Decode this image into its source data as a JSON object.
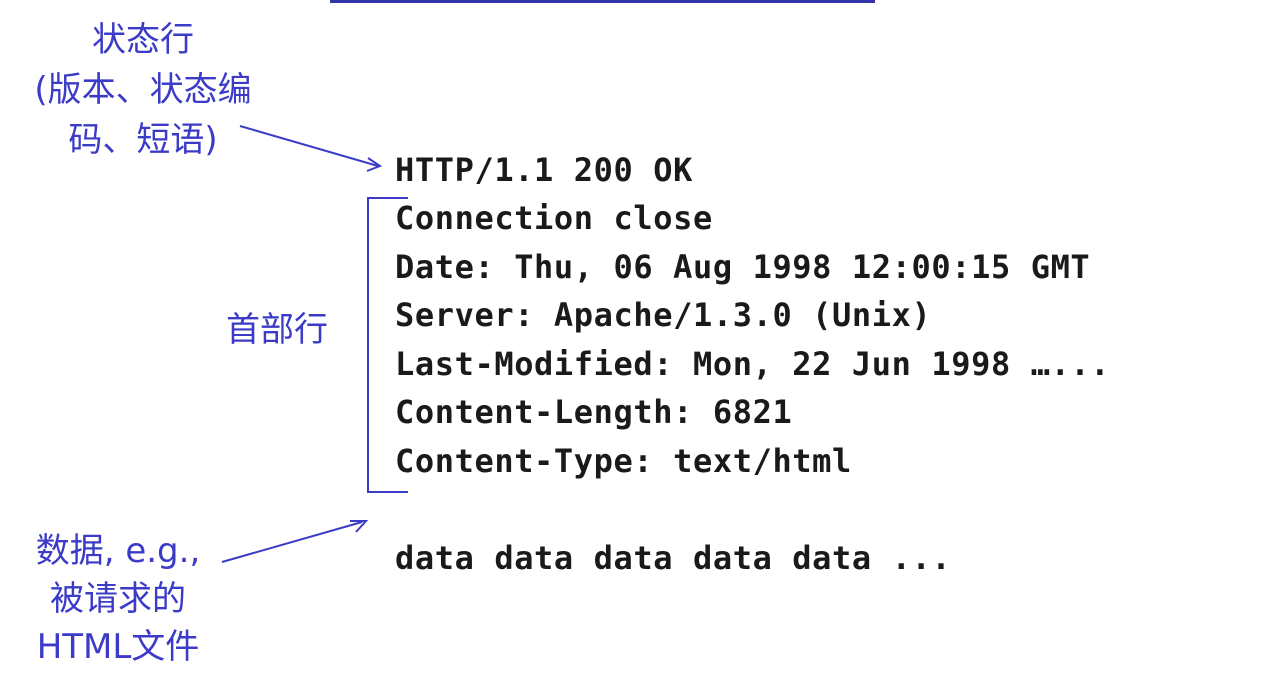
{
  "labels": {
    "status_line": [
      "状态行",
      "(版本、状态编",
      "码、短语)"
    ],
    "header_lines": "首部行",
    "data": {
      "line1": "数据, e.g.,",
      "line2": "被请求的",
      "line3": "HTML文件"
    }
  },
  "message": {
    "status_line": "HTTP/1.1 200 OK",
    "headers": [
      "Connection close",
      "Date: Thu, 06 Aug 1998 12:00:15 GMT",
      "Server: Apache/1.3.0 (Unix)",
      "Last-Modified: Mon, 22 Jun 1998 …...",
      "Content-Length: 6821",
      "Content-Type: text/html"
    ],
    "body": "data data data data data ..."
  },
  "colors": {
    "annotation": "#3b3bc8",
    "text": "#1a1a1a"
  }
}
